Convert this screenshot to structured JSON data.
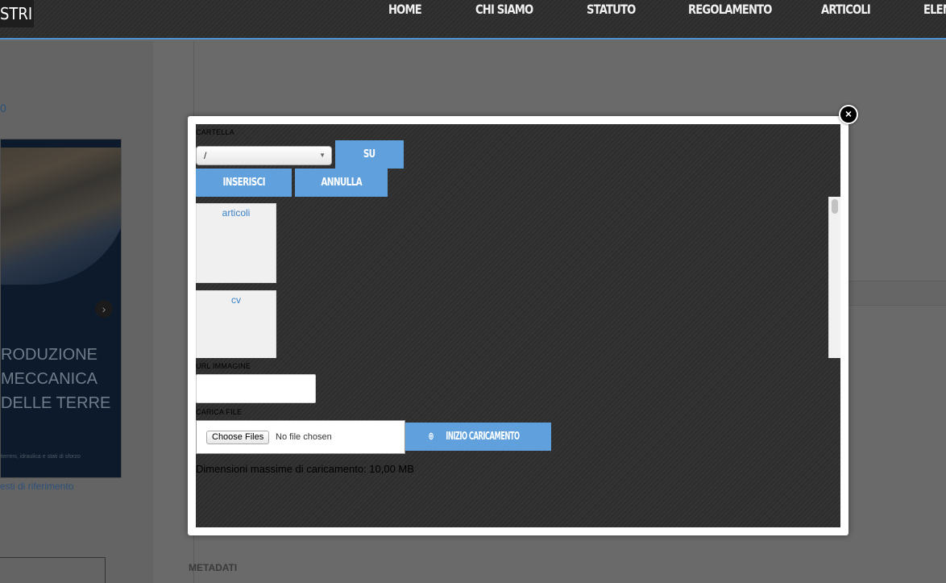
{
  "header": {
    "logo_text": "STRI",
    "nav": [
      "HOME",
      "CHI SIAMO",
      "STATUTO",
      "REGOLAMENTO",
      "ARTICOLI",
      "ELEN"
    ]
  },
  "background": {
    "link_top": "0",
    "book": {
      "title_lines": [
        "RODUZIONE",
        "MECCANICA",
        "DELLE TERRE"
      ],
      "subtitle": "terreni, idraulica e stati di sforzo"
    },
    "link_bottom": "esti di riferimento",
    "metadati_label": "METADATI"
  },
  "modal": {
    "close_icon": "close-icon",
    "folder_label": "CARTELLA",
    "folder_select_value": "/",
    "up_button": "SU",
    "insert_button": "INSERISCI",
    "cancel_button": "ANNULLA",
    "folders": [
      "articoli",
      "cv"
    ],
    "url_label": "URL IMMAGINE",
    "url_value": "",
    "upload_label": "CARICA FILE",
    "choose_files": "Choose Files",
    "no_file": "No file chosen",
    "start_upload_button": "INIZIO CARICAMENTO",
    "max_size_text": "Dimensioni massime di caricamento: 10,00 MB"
  },
  "colors": {
    "accent_blue": "#5fa0dd",
    "nav_underline": "#4f8fd0",
    "folder_link": "#3b82c8"
  }
}
